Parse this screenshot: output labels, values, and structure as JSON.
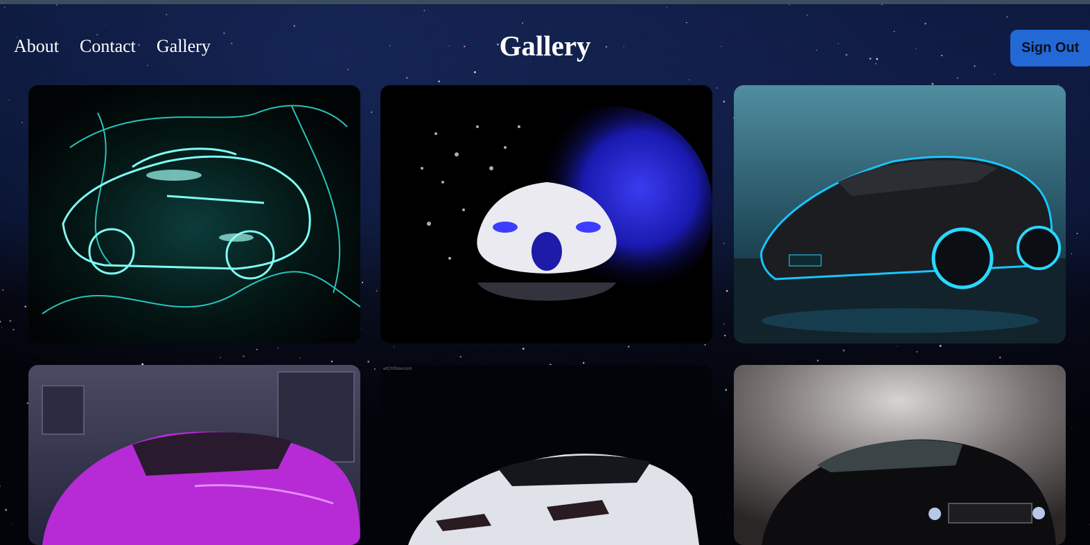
{
  "nav": {
    "links": [
      "About",
      "Contact",
      "Gallery"
    ]
  },
  "page": {
    "title": "Gallery"
  },
  "header": {
    "sign_out_label": "Sign Out"
  },
  "gallery": {
    "items": [
      {
        "name": "neon-cyan-car-image"
      },
      {
        "name": "white-blue-smoke-car-image"
      },
      {
        "name": "black-lamborghini-blue-neon-image"
      },
      {
        "name": "purple-lamborghini-image"
      },
      {
        "name": "white-lamborghini-image"
      },
      {
        "name": "black-mustang-image"
      }
    ],
    "watermark_text": "wtChShow.com"
  },
  "colors": {
    "accent_button": "#2269d6",
    "background": "#03040a",
    "topbar": "#3a4e5e"
  }
}
